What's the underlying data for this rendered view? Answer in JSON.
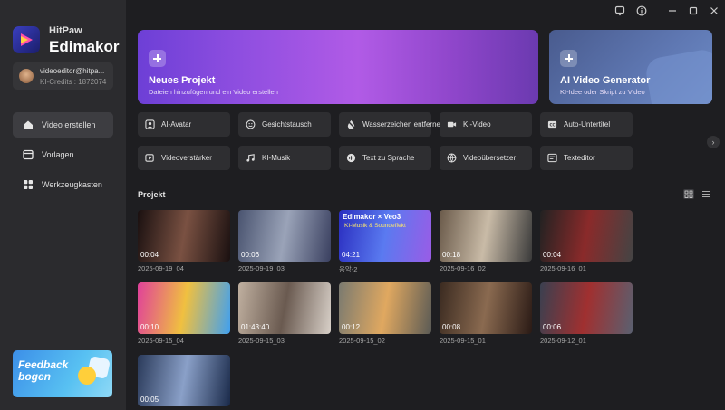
{
  "brand": {
    "top": "HitPaw",
    "name": "Edimakor"
  },
  "account": {
    "email": "videoeditor@hitpa...",
    "credits": "KI-Credits : 1872074"
  },
  "nav": [
    {
      "label": "Video erstellen",
      "icon": "home-icon",
      "active": true
    },
    {
      "label": "Vorlagen",
      "icon": "template-icon",
      "active": false
    },
    {
      "label": "Werkzeugkasten",
      "icon": "toolbox-icon",
      "active": false
    }
  ],
  "feedback": {
    "label": "Feedback bogen"
  },
  "window_controls": [
    "message-icon",
    "info-icon",
    "minimize-icon",
    "maximize-icon",
    "close-icon"
  ],
  "new_project": {
    "title": "Neues Projekt",
    "subtitle": "Dateien hinzufügen und ein Video erstellen"
  },
  "ai_generator": {
    "title": "AI Video Generator",
    "subtitle": "KI-Idee oder Skript zu Video"
  },
  "tools": [
    {
      "label": "AI-Avatar",
      "icon": "avatar-icon"
    },
    {
      "label": "Gesichtstausch",
      "icon": "face-swap-icon"
    },
    {
      "label": "Wasserzeichen entfernen",
      "icon": "watermark-remove-icon"
    },
    {
      "label": "KI-Video",
      "icon": "ai-video-icon"
    },
    {
      "label": "Auto-Untertitel",
      "icon": "subtitle-icon"
    },
    {
      "label": "Videoverstärker",
      "icon": "enhancer-icon"
    },
    {
      "label": "KI-Musik",
      "icon": "music-icon"
    },
    {
      "label": "Text zu Sprache",
      "icon": "tts-icon"
    },
    {
      "label": "Videoübersetzer",
      "icon": "translate-icon"
    },
    {
      "label": "Texteditor",
      "icon": "text-editor-icon"
    }
  ],
  "projects_title": "Projekt",
  "projects": [
    {
      "name": "2025-09-19_04",
      "duration": "00:04",
      "colors": [
        "#1a1010",
        "#7a5142",
        "#1a1010"
      ]
    },
    {
      "name": "2025-09-19_03",
      "duration": "00:06",
      "colors": [
        "#4a5470",
        "#9aa3b8",
        "#3a4060"
      ]
    },
    {
      "name": "음악-2",
      "duration": "04:21",
      "colors": [
        "#2a2ec0",
        "#5a7af0",
        "#9a5ce6"
      ],
      "overlay": "Edimakor × Veo3",
      "overlay2": "KI-Musik & Soundeffekt"
    },
    {
      "name": "2025-09-16_02",
      "duration": "00:18",
      "colors": [
        "#6a5a4a",
        "#c9bba7",
        "#3a3a3a"
      ]
    },
    {
      "name": "2025-09-16_01",
      "duration": "00:04",
      "colors": [
        "#222",
        "#8a2a2a",
        "#444"
      ]
    },
    {
      "name": "2025-09-15_04",
      "duration": "00:10",
      "colors": [
        "#e0409a",
        "#f0c040",
        "#40a0f0"
      ]
    },
    {
      "name": "2025-09-15_03",
      "duration": "01:43:40",
      "colors": [
        "#c0b0a0",
        "#6a5a50",
        "#d8d0c8"
      ]
    },
    {
      "name": "2025-09-15_02",
      "duration": "00:12",
      "colors": [
        "#7a7a70",
        "#e0a860",
        "#5a5a55"
      ]
    },
    {
      "name": "2025-09-15_01",
      "duration": "00:08",
      "colors": [
        "#3a2a20",
        "#8a6a50",
        "#2a1a15"
      ]
    },
    {
      "name": "2025-09-12_01",
      "duration": "00:06",
      "colors": [
        "#3a4050",
        "#a03030",
        "#5a6070"
      ]
    },
    {
      "name": "",
      "duration": "00:05",
      "colors": [
        "#2a3a5a",
        "#8aa0c8",
        "#1a2a4a"
      ]
    }
  ]
}
